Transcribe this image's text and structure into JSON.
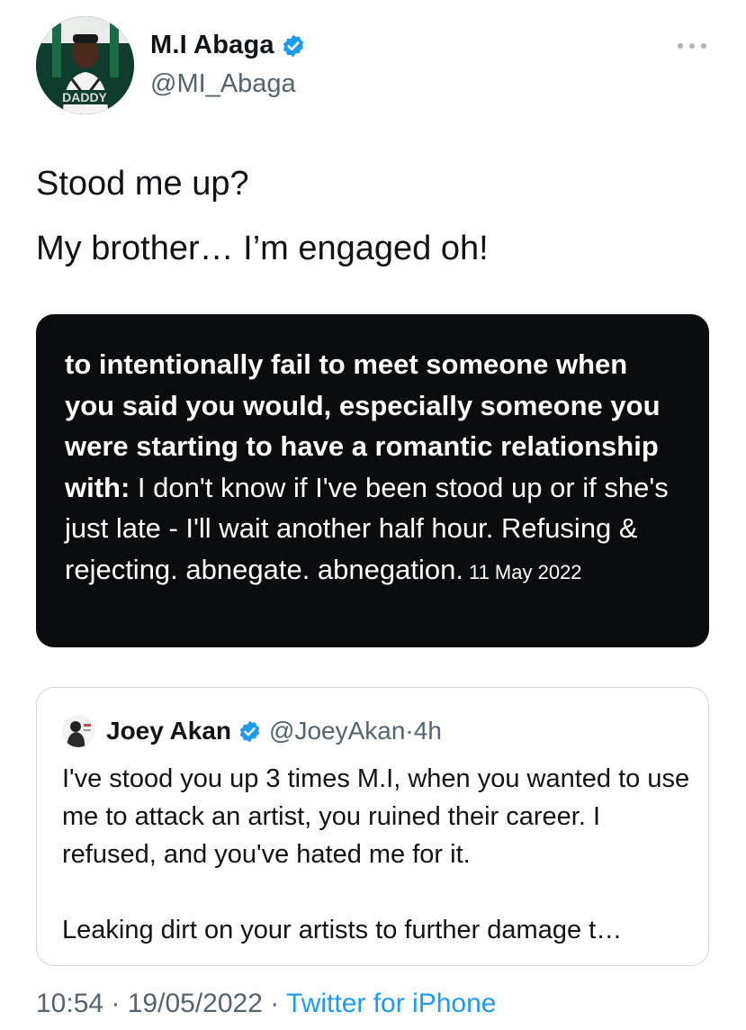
{
  "author": {
    "display_name": "M.I Abaga",
    "handle": "@MI_Abaga",
    "avatar_text": "DADDY"
  },
  "tweet": {
    "line1": "Stood me up?",
    "line2": "My brother… I’m engaged oh!"
  },
  "media_card": {
    "bold_text": "to intentionally fail to meet someone when you said you would, especially someone you were starting to have a romantic relationship with:",
    "regular_text": " I don't know if I've been stood up or if she's just late - I'll wait another half hour. Refusing & rejecting. abnegate. abnegation.",
    "date": "11 May 2022"
  },
  "quoted_tweet": {
    "display_name": "Joey Akan",
    "handle": "@JoeyAkan",
    "separator": "·",
    "age": "4h",
    "paragraph1": "I've stood you up 3 times M.I, when you wanted to use me to attack an artist,  you ruined their career. I refused, and you've hated me for it.",
    "paragraph2": "Leaking dirt on your artists to further damage t…"
  },
  "footer": {
    "time": "10:54",
    "sep1": " · ",
    "date": "19/05/2022",
    "sep2": " · ",
    "source": "Twitter for iPhone"
  },
  "colors": {
    "accent": "#1d9bf0",
    "secondary_text": "#536471",
    "media_bg": "#0b0c10"
  },
  "icons": [
    "verified-badge-icon",
    "more-options-icon"
  ]
}
